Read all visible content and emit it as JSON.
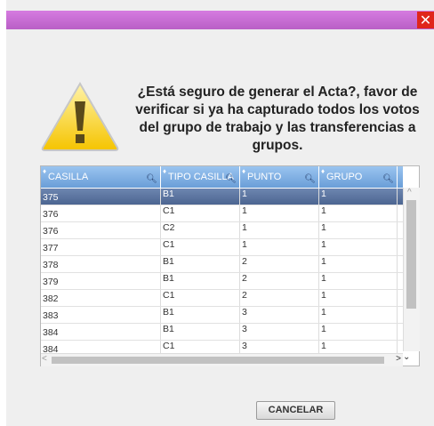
{
  "dialog": {
    "close_label": "✕",
    "message": "¿Está seguro de generar el Acta?, favor de verificar si ya ha capturado todos los votos del grupo de trabajo y las transferencias a grupos.",
    "cancel_label": "CANCELAR",
    "accent": "#c86fd4"
  },
  "table": {
    "columns": [
      "CASILLA",
      "TIPO CASILLA",
      "PUNTO",
      "GRUPO"
    ],
    "rows": [
      [
        "375",
        "B1",
        "1",
        "1"
      ],
      [
        "376",
        "C1",
        "1",
        "1"
      ],
      [
        "376",
        "C2",
        "1",
        "1"
      ],
      [
        "377",
        "C1",
        "1",
        "1"
      ],
      [
        "378",
        "B1",
        "2",
        "1"
      ],
      [
        "379",
        "B1",
        "2",
        "1"
      ],
      [
        "382",
        "C1",
        "2",
        "1"
      ],
      [
        "383",
        "B1",
        "3",
        "1"
      ],
      [
        "384",
        "B1",
        "3",
        "1"
      ],
      [
        "384",
        "C1",
        "3",
        "1"
      ]
    ],
    "selected_row": 0
  },
  "icons": [
    "warning-icon",
    "close-icon",
    "search-icon",
    "sort-icon"
  ]
}
